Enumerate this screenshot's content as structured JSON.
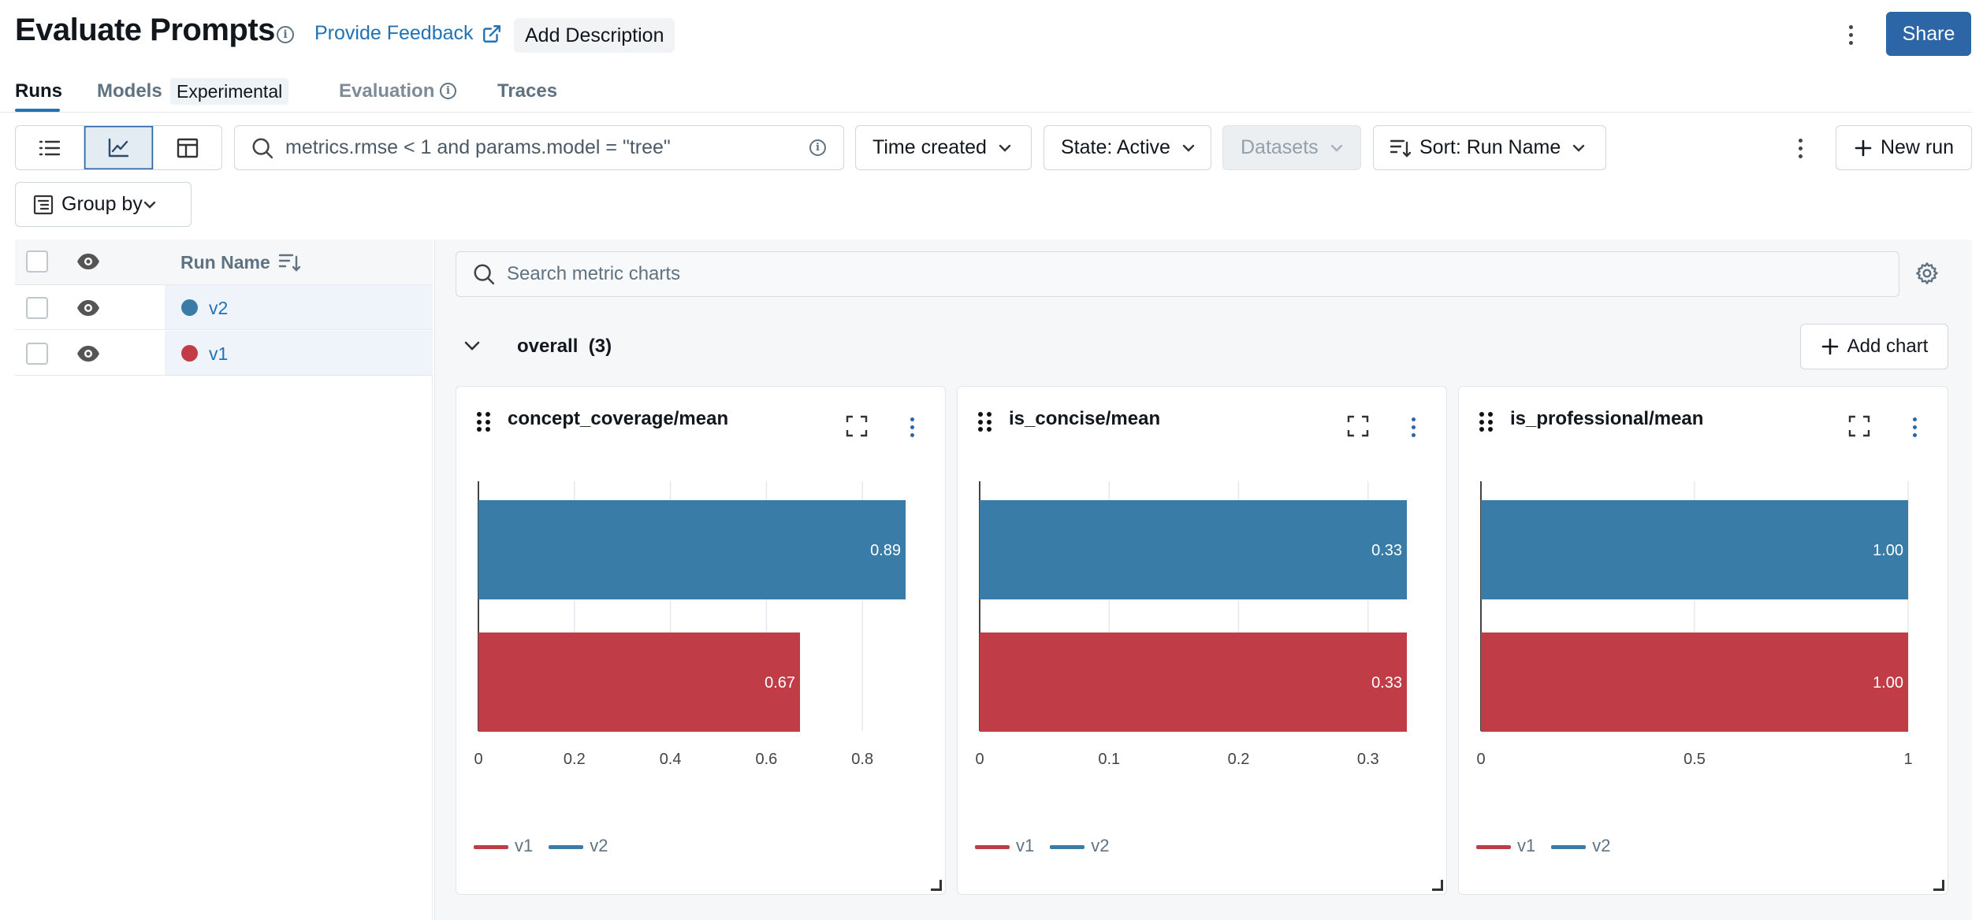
{
  "header": {
    "title": "Evaluate Prompts",
    "feedback_label": "Provide Feedback",
    "add_description_label": "Add Description",
    "share_label": "Share"
  },
  "tabs": [
    {
      "label": "Runs",
      "active": true
    },
    {
      "label": "Models",
      "badge": "Experimental"
    },
    {
      "label": "Evaluation"
    },
    {
      "label": "Traces"
    }
  ],
  "toolbar": {
    "search_placeholder": "metrics.rmse < 1 and params.model = \"tree\"",
    "time_label": "Time created",
    "state_label": "State: Active",
    "datasets_label": "Datasets",
    "sort_label": "Sort: Run Name",
    "new_run_label": "New run",
    "group_by_label": "Group by"
  },
  "runs_table": {
    "header": "Run Name",
    "rows": [
      {
        "name": "v2",
        "color": "#3a7ca8"
      },
      {
        "name": "v1",
        "color": "#c03d47"
      }
    ]
  },
  "charts_panel": {
    "search_placeholder": "Search metric charts",
    "section_label": "overall",
    "section_count": "(3)",
    "add_chart_label": "Add chart"
  },
  "colors": {
    "v1": "#c03d47",
    "v2": "#3a7ca8",
    "accent": "#2272b4"
  },
  "chart_data": [
    {
      "type": "bar",
      "orientation": "horizontal",
      "title": "concept_coverage/mean",
      "categories": [
        "v2",
        "v1"
      ],
      "values": [
        0.89,
        0.67
      ],
      "labels": [
        "0.89",
        "0.67"
      ],
      "xlim": [
        0,
        0.89
      ],
      "ticks": [
        "0",
        "0.2",
        "0.4",
        "0.6",
        "0.8"
      ],
      "tick_values": [
        0,
        0.2,
        0.4,
        0.6,
        0.8
      ],
      "legend": [
        "v1",
        "v2"
      ]
    },
    {
      "type": "bar",
      "orientation": "horizontal",
      "title": "is_concise/mean",
      "categories": [
        "v2",
        "v1"
      ],
      "values": [
        0.33,
        0.33
      ],
      "labels": [
        "0.33",
        "0.33"
      ],
      "xlim": [
        0,
        0.33
      ],
      "ticks": [
        "0",
        "0.1",
        "0.2",
        "0.3"
      ],
      "tick_values": [
        0,
        0.1,
        0.2,
        0.3
      ],
      "legend": [
        "v1",
        "v2"
      ]
    },
    {
      "type": "bar",
      "orientation": "horizontal",
      "title": "is_professional/mean",
      "categories": [
        "v2",
        "v1"
      ],
      "values": [
        1.0,
        1.0
      ],
      "labels": [
        "1.00",
        "1.00"
      ],
      "xlim": [
        0,
        1
      ],
      "ticks": [
        "0",
        "0.5",
        "1"
      ],
      "tick_values": [
        0,
        0.5,
        1
      ],
      "legend": [
        "v1",
        "v2"
      ]
    }
  ]
}
